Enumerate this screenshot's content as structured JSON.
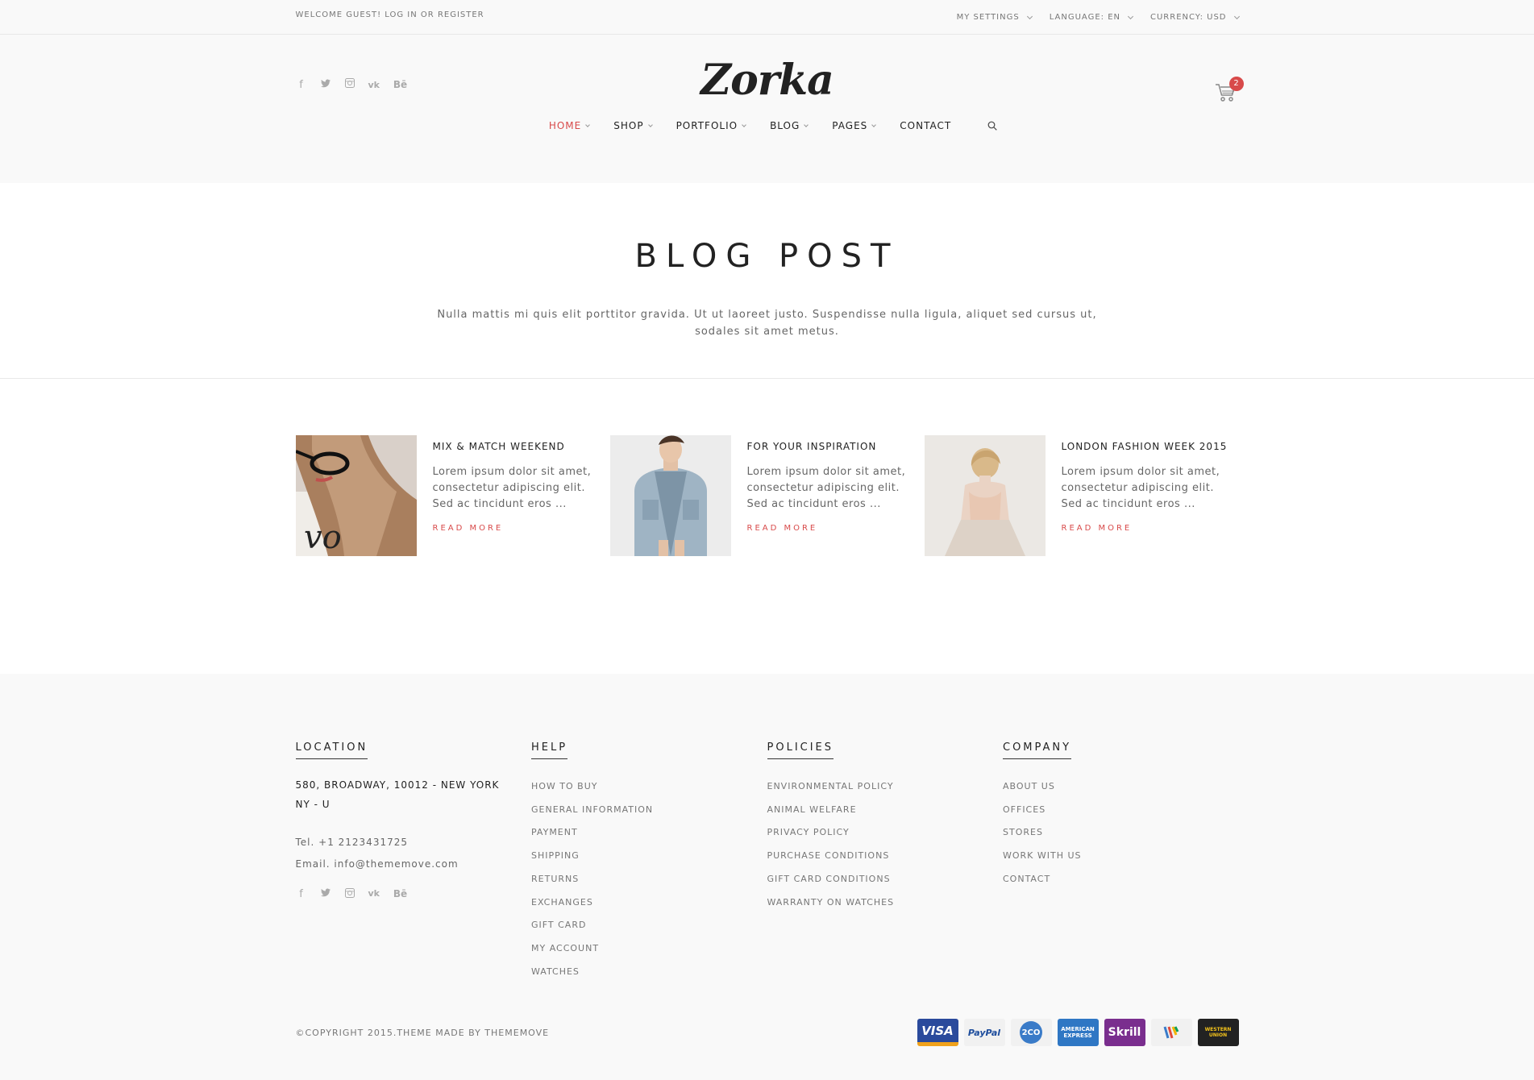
{
  "topbar": {
    "welcome_prefix": "WELCOME GUEST! ",
    "login": "LOG IN",
    "or": " OR ",
    "register": "REGISTER",
    "settings": [
      "MY SETTINGS",
      "LANGUAGE: EN",
      "CURRENCY: USD"
    ]
  },
  "header": {
    "logo": "Zorka",
    "cart_count": "2",
    "nav": [
      {
        "label": "HOME",
        "dropdown": true,
        "active": true
      },
      {
        "label": "SHOP",
        "dropdown": true
      },
      {
        "label": "PORTFOLIO",
        "dropdown": true
      },
      {
        "label": "BLOG",
        "dropdown": true
      },
      {
        "label": "PAGES",
        "dropdown": true
      },
      {
        "label": "CONTACT",
        "dropdown": false
      }
    ]
  },
  "page_title": {
    "title": "BLOG POST",
    "subtitle": "Nulla mattis mi quis elit porttitor gravida. Ut ut laoreet justo. Suspendisse nulla ligula, aliquet sed cursus ut, sodales sit amet metus."
  },
  "posts": [
    {
      "title": "MIX & MATCH WEEKEND",
      "excerpt": "Lorem ipsum dolor sit amet, consectetur adipiscing elit. Sed ac tincidunt eros ...",
      "readmore": "READ MORE"
    },
    {
      "title": "FOR YOUR INSPIRATION",
      "excerpt": "Lorem ipsum dolor sit amet, consectetur adipiscing elit. Sed ac tincidunt eros ...",
      "readmore": "READ MORE"
    },
    {
      "title": "LONDON FASHION WEEK 2015",
      "excerpt": "Lorem ipsum dolor sit amet, consectetur adipiscing elit. Sed ac tincidunt eros ...",
      "readmore": "READ MORE"
    }
  ],
  "footer": {
    "location": {
      "heading": "LOCATION",
      "address": "580, BROADWAY, 10012 - NEW YORK NY - U",
      "tel": "Tel. +1 2123431725",
      "email": "Email. info@thememove.com"
    },
    "help": {
      "heading": "HELP",
      "items": [
        "HOW TO BUY",
        "GENERAL INFORMATION",
        "PAYMENT",
        "SHIPPING",
        "RETURNS",
        "EXCHANGES",
        "GIFT CARD",
        "MY ACCOUNT",
        "WATCHES"
      ]
    },
    "policies": {
      "heading": "POLICIES",
      "items": [
        "ENVIRONMENTAL POLICY",
        "ANIMAL WELFARE",
        "PRIVACY POLICY",
        "PURCHASE CONDITIONS",
        "GIFT CARD CONDITIONS",
        "WARRANTY ON WATCHES"
      ]
    },
    "company": {
      "heading": "COMPANY",
      "items": [
        "ABOUT US",
        "OFFICES",
        "STORES",
        "WORK WITH US",
        "CONTACT"
      ]
    },
    "copyright": "©COPYRIGHT 2015.THEME MADE BY THEMEMOVE",
    "payments": [
      {
        "name": "VISA",
        "bg": "#2a4a9c"
      },
      {
        "name": "PayPal",
        "bg": "#f1f1f1"
      },
      {
        "name": "2CO",
        "bg": "#f1f1f1"
      },
      {
        "name": "AMERICAN EXPRESS",
        "bg": "#2f77c4"
      },
      {
        "name": "Skrill",
        "bg": "#7a2e8e"
      },
      {
        "name": "Google Wallet",
        "bg": "#f1f1f1"
      },
      {
        "name": "WESTERN UNION",
        "bg": "#222222"
      }
    ]
  },
  "colors": {
    "accent": "#d84a4a",
    "text_dark": "#222222",
    "text_muted": "#777777",
    "bg_light": "#f9f9f9"
  }
}
